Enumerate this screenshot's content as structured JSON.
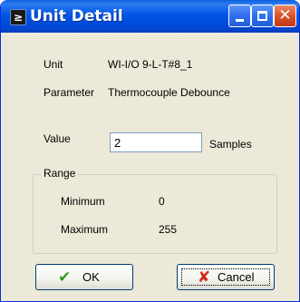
{
  "window": {
    "title": "Unit Detail",
    "app_icon": "≥"
  },
  "title_buttons": {
    "minimize_icon": "minimize-icon",
    "maximize_icon": "maximize-icon",
    "close_icon": "close-icon",
    "close_glyph": "✕"
  },
  "fields": {
    "unit_label": "Unit",
    "unit_value": "WI-I/O 9-L-T#8_1",
    "parameter_label": "Parameter",
    "parameter_value": "Thermocouple Debounce",
    "value_label": "Value",
    "value_input": "2",
    "value_units": "Samples"
  },
  "range": {
    "title": "Range",
    "minimum_label": "Minimum",
    "minimum_value": "0",
    "maximum_label": "Maximum",
    "maximum_value": "255"
  },
  "buttons": {
    "ok_label": "OK",
    "ok_glyph": "✔",
    "cancel_label": "Cancel",
    "cancel_glyph": "✘"
  },
  "colors": {
    "titlebar": "#0055e5",
    "dialog_bg": "#ece9d8",
    "ok_icon": "#2e9e22",
    "cancel_icon": "#d12a1a",
    "close_button": "#d9542b"
  }
}
